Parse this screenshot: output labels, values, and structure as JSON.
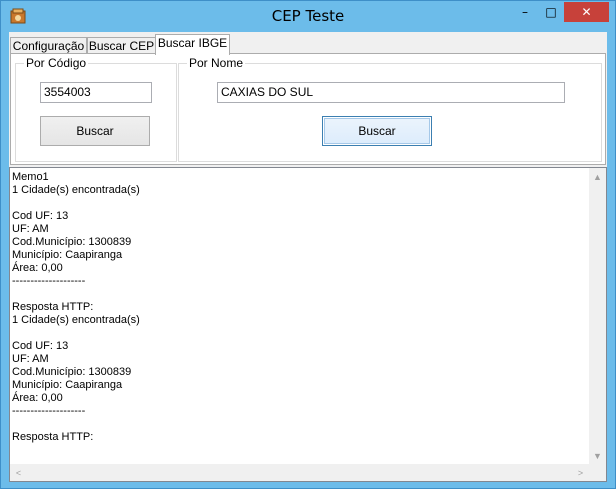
{
  "window": {
    "title": "CEP Teste",
    "controls": {
      "minimize": "–",
      "maximize": "□",
      "close": "✕"
    }
  },
  "tabs": [
    {
      "label": "Configuração"
    },
    {
      "label": "Buscar CEP"
    },
    {
      "label": "Buscar IBGE"
    }
  ],
  "por_codigo": {
    "legend": "Por Código",
    "code_value": "3554003",
    "button_label": "Buscar"
  },
  "por_nome": {
    "legend": "Por Nome",
    "name_value": "CAXIAS DO SUL",
    "button_label": "Buscar"
  },
  "memo": {
    "text": "Memo1\n1 Cidade(s) encontrada(s)\n\nCod UF: 13\nUF: AM\nCod.Município: 1300839\nMunicípio: Caapiranga\nÁrea: 0,00\n--------------------\n\nResposta HTTP:\n1 Cidade(s) encontrada(s)\n\nCod UF: 13\nUF: AM\nCod.Município: 1300839\nMunicípio: Caapiranga\nÁrea: 0,00\n--------------------\n\nResposta HTTP:"
  },
  "scroll": {
    "up": "▲",
    "down": "▼",
    "left": "<",
    "right": ">"
  }
}
